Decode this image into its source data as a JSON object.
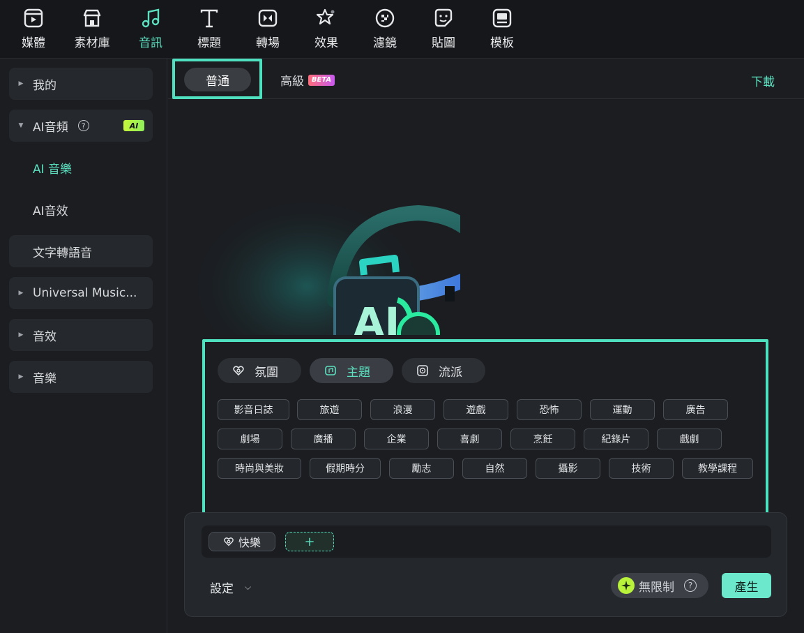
{
  "toolbar": {
    "items": [
      {
        "label": "媒體",
        "icon": "media-icon"
      },
      {
        "label": "素材庫",
        "icon": "store-icon"
      },
      {
        "label": "音訊",
        "icon": "music-note-icon"
      },
      {
        "label": "標題",
        "icon": "text-icon"
      },
      {
        "label": "轉場",
        "icon": "transition-icon"
      },
      {
        "label": "效果",
        "icon": "effects-icon"
      },
      {
        "label": "濾鏡",
        "icon": "filter-icon"
      },
      {
        "label": "貼圖",
        "icon": "sticker-icon"
      },
      {
        "label": "模板",
        "icon": "template-icon"
      }
    ],
    "active": "音訊",
    "accent": "#5ce0c0"
  },
  "sidebar": {
    "items": [
      {
        "label": "我的"
      },
      {
        "label": "AI音頻",
        "badge": "AI"
      },
      {
        "label": "AI 音樂"
      },
      {
        "label": "AI音效"
      },
      {
        "label": "文字轉語音"
      },
      {
        "label": "Universal Music..."
      },
      {
        "label": "音效"
      },
      {
        "label": "音樂"
      }
    ]
  },
  "tabs": {
    "normal": "普通",
    "advanced": "高級",
    "beta": "BETA",
    "download": "下載"
  },
  "hero": {
    "text": "AI"
  },
  "categories": [
    {
      "label": "氛圍",
      "icon": "mood-icon"
    },
    {
      "label": "主題",
      "icon": "theme-icon"
    },
    {
      "label": "流派",
      "icon": "genre-icon"
    }
  ],
  "tags": {
    "row1": [
      "影音日誌",
      "旅遊",
      "浪漫",
      "遊戲",
      "恐怖",
      "運動",
      "廣告"
    ],
    "row2": [
      "劇場",
      "廣播",
      "企業",
      "喜劇",
      "烹飪",
      "紀錄片",
      "戲劇"
    ],
    "row3": [
      "時尚與美妝",
      "假期時分",
      "勵志",
      "自然",
      "攝影",
      "技術",
      "教學課程"
    ]
  },
  "prompt": {
    "chip": "快樂",
    "add": "+",
    "settings": "設定",
    "unlimited": "無限制",
    "help": "?",
    "generate": "產生"
  }
}
